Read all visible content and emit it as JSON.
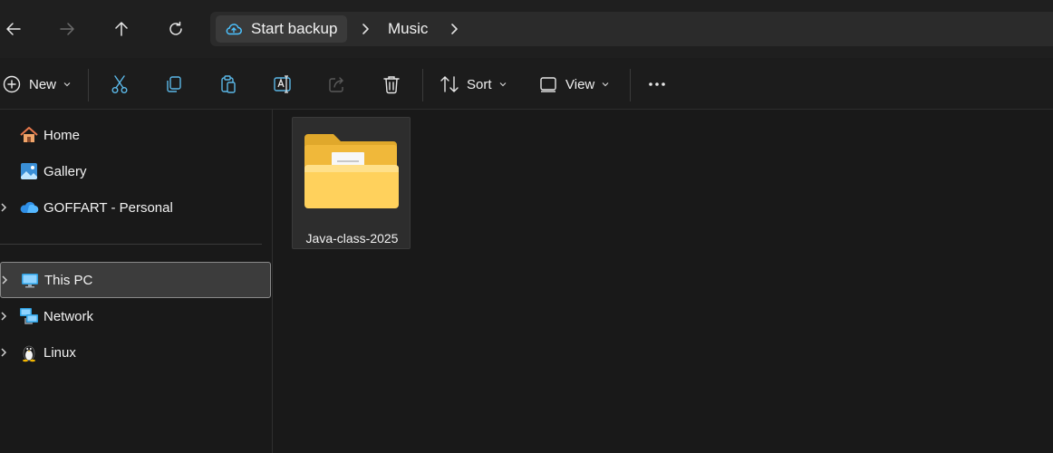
{
  "navigation": {
    "back_icon": "arrow-left-icon",
    "forward_icon": "arrow-right-icon",
    "up_icon": "arrow-up-icon",
    "refresh_icon": "refresh-icon"
  },
  "breadcrumb": {
    "items": [
      "Start backup",
      "Music"
    ],
    "root_icon": "cloud-backup-icon"
  },
  "toolbar": {
    "new_label": "New",
    "sort_label": "Sort",
    "view_label": "View",
    "icons": [
      "cut-icon",
      "copy-icon",
      "paste-icon",
      "rename-icon",
      "share-icon",
      "delete-icon",
      "more-icon"
    ]
  },
  "sidebar": {
    "items": [
      {
        "label": "Home",
        "icon": "home-icon"
      },
      {
        "label": "Gallery",
        "icon": "gallery-icon"
      },
      {
        "label": "GOFFART - Personal",
        "icon": "onedrive-cloud-icon"
      },
      {
        "label": "This PC",
        "icon": "monitor-icon",
        "selected": true
      },
      {
        "label": "Network",
        "icon": "network-icon"
      },
      {
        "label": "Linux",
        "icon": "linux-penguin-icon"
      }
    ]
  },
  "content": {
    "items": [
      {
        "name": "Java-class-2025",
        "type": "folder",
        "icon": "folder-icon"
      }
    ]
  },
  "colors": {
    "background": "#191919",
    "selection": "#3c3c3c",
    "folder_yellow": "#f6c141",
    "accent_blue": "#4cc2ff"
  }
}
